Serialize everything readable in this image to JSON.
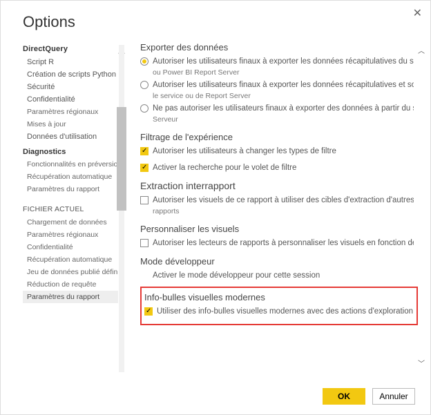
{
  "title": "Options",
  "close": "✕",
  "sidebar": {
    "global_section": "DirectQuery",
    "global_items": [
      "Script R",
      "Création de scripts Python",
      "Sécurité",
      "Confidentialité",
      "Paramètres régionaux",
      "Mises à jour",
      "Données d'utilisation"
    ],
    "diag_label": "Diagnostics",
    "diag_items": [
      "Fonctionnalités en préversion",
      "Récupération automatique",
      "Paramètres du rapport"
    ],
    "file_section": "FICHIER ACTUEL",
    "file_items": [
      "Chargement de données",
      "Paramètres régionaux",
      "Confidentialité",
      "Récupération automatique",
      "Jeu de données publié défini…",
      "Réduction de requête",
      "Paramètres du rapport"
    ]
  },
  "main": {
    "export_head": "Exporter des données",
    "export_opt1a": "Autoriser les utilisateurs finaux à exporter les données récapitulatives du se",
    "export_opt1b": "ou Power BI Report Server",
    "export_opt2a": "Autoriser les utilisateurs finaux à exporter les données récapitulatives et sou",
    "export_opt2b": "le service ou de Report Server",
    "export_opt3a": "Ne pas autoriser les utilisateurs finaux à exporter des données à partir du s",
    "export_opt3b": "Serveur",
    "filter_head": "Filtrage de l'expérience",
    "filter_opt1": "Autoriser les utilisateurs à changer les types de filtre",
    "filter_opt2": "Activer la recherche pour le volet de filtre",
    "cross_head": "Extraction interrapport",
    "cross_opt1a": "Autoriser les visuels de ce rapport à utiliser des cibles d'extraction d'autres",
    "cross_opt1b": "rapports",
    "perso_head": "Personnaliser les visuels",
    "perso_opt1": "Autoriser les lecteurs de rapports à personnaliser les visuels en fonction de",
    "dev_head": "Mode développeur",
    "dev_opt1": "Activer le mode développeur pour cette session",
    "tooltip_head": "Info-bulles visuelles modernes",
    "tooltip_opt1": "Utiliser des info-bulles visuelles modernes avec des actions d'exploration e"
  },
  "buttons": {
    "ok": "OK",
    "cancel": "Annuler"
  }
}
